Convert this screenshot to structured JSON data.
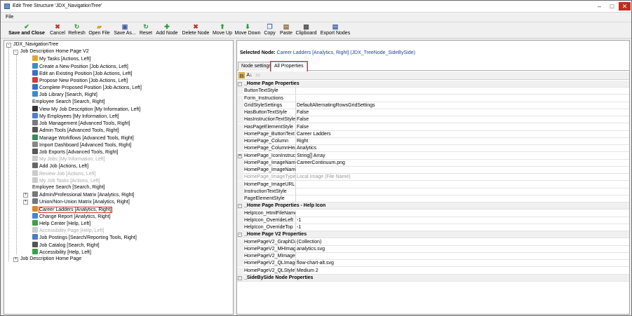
{
  "window": {
    "title": "Edit Tree Structure 'JDX_NavigationTree'"
  },
  "menu": {
    "file": "File"
  },
  "toolbar": [
    {
      "label": "Save and Close",
      "icon": "✔",
      "color": "#2e9b3a",
      "name": "save-and-close-button",
      "bold": true
    },
    {
      "label": "Cancel",
      "icon": "✖",
      "color": "#c0392b",
      "name": "cancel-button"
    },
    {
      "label": "Refresh",
      "icon": "↻",
      "color": "#3a9b3a",
      "name": "refresh-button"
    },
    {
      "label": "Open File",
      "icon": "▰",
      "color": "#e0a020",
      "name": "open-file-button"
    },
    {
      "label": "Save As...",
      "icon": "▣",
      "color": "#3c5e9c",
      "name": "save-as-button"
    },
    {
      "label": "Reset",
      "icon": "↻",
      "color": "#3a9b3a",
      "name": "reset-button"
    },
    {
      "label": "Add Node",
      "icon": "✚",
      "color": "#2e9b3a",
      "name": "add-node-button"
    },
    {
      "label": "Delete Node",
      "icon": "✖",
      "color": "#c0392b",
      "name": "delete-node-button"
    },
    {
      "label": "Move Up",
      "icon": "⬆",
      "color": "#2e9b3a",
      "name": "move-up-button"
    },
    {
      "label": "Move Down",
      "icon": "⬇",
      "color": "#2e9b3a",
      "name": "move-down-button"
    },
    {
      "label": "Copy",
      "icon": "❐",
      "color": "#4a6ca8",
      "name": "copy-button"
    },
    {
      "label": "Paste",
      "icon": "▤",
      "color": "#8a6a3a",
      "name": "paste-button"
    },
    {
      "label": "Clipboard",
      "icon": "▦",
      "color": "#555555",
      "name": "clipboard-button"
    },
    {
      "label": "Export Nodes",
      "icon": "▤",
      "color": "#3c5e9c",
      "name": "export-nodes-button"
    }
  ],
  "tree": [
    {
      "label": "JDX_NavigationTree",
      "level": 0,
      "expander": "-",
      "icon": ""
    },
    {
      "label": "Job Description Home Page V2",
      "level": 1,
      "expander": "-",
      "icon": ""
    },
    {
      "label": "My Tasks [Actions, Left]",
      "level": 2,
      "icon": "#e7a23a"
    },
    {
      "label": "Create a New Position [Job Actions, Left]",
      "level": 2,
      "icon": "#3a8ad6"
    },
    {
      "label": "Edit an Existing Position [Job Actions, Left]",
      "level": 2,
      "icon": "#3a6fc4"
    },
    {
      "label": "Propose New Position [Job Actions, Left]",
      "level": 2,
      "icon": "#d33a3a"
    },
    {
      "label": "Complete Proposed Position [Job Actions, Left]",
      "level": 2,
      "icon": "#3a6fc4"
    },
    {
      "label": "Job Library [Search, Right]",
      "level": 2,
      "icon": "#3a8ad6"
    },
    {
      "label": "Employee Search [Search, Right]",
      "level": 2,
      "icon": ""
    },
    {
      "label": "View My Job Description [My Information, Left]",
      "level": 2,
      "icon": "#333333"
    },
    {
      "label": "My Employees [My Information, Left]",
      "level": 2,
      "icon": "#4f7fc9"
    },
    {
      "label": "Job Management [Advanced Tools, Right]",
      "level": 2,
      "icon": "#7a7a7a"
    },
    {
      "label": "Admin Tools [Advanced Tools, Right]",
      "level": 2,
      "icon": "#555555"
    },
    {
      "label": "Manage Workflows [Advanced Tools, Right]",
      "level": 2,
      "icon": "#3a8a5a"
    },
    {
      "label": "Import Dashboard [Advanced Tools, Right]",
      "level": 2,
      "icon": "#888888"
    },
    {
      "label": "Job Exports [Advanced Tools, Right]",
      "level": 2,
      "icon": "#5a5a5a"
    },
    {
      "label": "My Jobs [My Information, Left]",
      "level": 2,
      "icon": "#cccccc",
      "disabled": true
    },
    {
      "label": "Add Job [Actions, Left]",
      "level": 2,
      "icon": "#666666"
    },
    {
      "label": "Review Job [Actions, Left]",
      "level": 2,
      "icon": "#cccccc",
      "disabled": true
    },
    {
      "label": "My Job Tasks [Actions, Left]",
      "level": 2,
      "icon": "#cccccc",
      "disabled": true
    },
    {
      "label": "Employee Search [Search, Right]",
      "level": 2,
      "icon": ""
    },
    {
      "label": "Admin/Professional Matrix [Analytics, Right]",
      "level": 2,
      "expander": "+",
      "icon": "#777777"
    },
    {
      "label": "Union/Non-Union Matrix [Analytics, Right]",
      "level": 2,
      "expander": "+",
      "icon": "#777777"
    },
    {
      "label": "Career Ladders [Analytics, Right]",
      "level": 2,
      "icon": "#d9892a",
      "highlight": true
    },
    {
      "label": "Change Report [Analytics, Right]",
      "level": 2,
      "icon": "#3a8ad6"
    },
    {
      "label": "Help Center [Help, Left]",
      "level": 2,
      "icon": "#3aa04a"
    },
    {
      "label": "Accessibility Page [Help, Left]",
      "level": 2,
      "icon": "#cccccc",
      "disabled": true
    },
    {
      "label": "Job Postings [Search/Reporting Tools, Right]",
      "level": 2,
      "icon": "#4a7ac4"
    },
    {
      "label": "Job Catalog [Search, Right]",
      "level": 2,
      "icon": "#555555"
    },
    {
      "label": "Accessibility [Help, Left]",
      "level": 2,
      "icon": "#3aa04a"
    },
    {
      "label": "Job Description Home Page",
      "level": 1,
      "expander": "+",
      "icon": ""
    }
  ],
  "selected_node": {
    "label": "Selected Node:",
    "value": "Career Ladders [Analytics, Right]",
    "type": "(JDX_TreeNode_SideBySide)"
  },
  "tabs": [
    {
      "label": "Node settings",
      "active": false
    },
    {
      "label": "All Properties",
      "active": true
    }
  ],
  "properties": [
    {
      "cat": true,
      "label": "_Home Page Properties",
      "exp": "-"
    },
    {
      "label": "ButtonTextStyle",
      "value": ""
    },
    {
      "label": "Form_Instructions",
      "value": ""
    },
    {
      "label": "GridStyleSettings",
      "value": "DefaultAlternatingRowsGridSettings"
    },
    {
      "label": "HasButtonTextStyle",
      "value": "False"
    },
    {
      "label": "HasInstructionTextStyle",
      "value": "False"
    },
    {
      "label": "HasPageElementStyle",
      "value": "False"
    },
    {
      "label": "HomePage_ButtonText",
      "value": "Career Ladders"
    },
    {
      "label": "HomePage_Column",
      "value": "Right"
    },
    {
      "label": "HomePage_ColumnHeadir",
      "value": "Analytics"
    },
    {
      "label": "HomePage_IconInstructio",
      "value": "String[] Array",
      "exp": "+"
    },
    {
      "label": "HomePage_ImageName",
      "value": "CareerContinuum.png"
    },
    {
      "label": "HomePage_ImageName_I",
      "value": ""
    },
    {
      "label": "HomePage_ImageType",
      "value": "Local Image (File Name)",
      "disabled": true
    },
    {
      "label": "HomePage_ImageURL",
      "value": ""
    },
    {
      "label": "InstructionTextStyle",
      "value": ""
    },
    {
      "label": "PageElementStyle",
      "value": ""
    },
    {
      "cat": true,
      "label": "_Home Page Properties - Help Icon",
      "exp": "-"
    },
    {
      "label": "HelpIcon_HtmlFileName",
      "value": ""
    },
    {
      "label": "HelpIcon_OverrideLeft",
      "value": "-1"
    },
    {
      "label": "HelpIcon_OverrideTop",
      "value": "-1"
    },
    {
      "cat": true,
      "label": "_Home Page V2 Properties",
      "exp": "-"
    },
    {
      "label": "HomePageV2_GraphData1",
      "value": "(Collection)"
    },
    {
      "label": "HomePageV2_MHImageN",
      "value": "analytics.svg"
    },
    {
      "label": "HomePageV2_MImageNar",
      "value": ""
    },
    {
      "label": "HomePageV2_QLImageNa",
      "value": "flow-chart-alt.svg"
    },
    {
      "label": "HomePageV2_QLStyleTyp",
      "value": "Medium 2"
    },
    {
      "cat": true,
      "label": "_SideBySide Node Properties",
      "exp": "-"
    }
  ]
}
